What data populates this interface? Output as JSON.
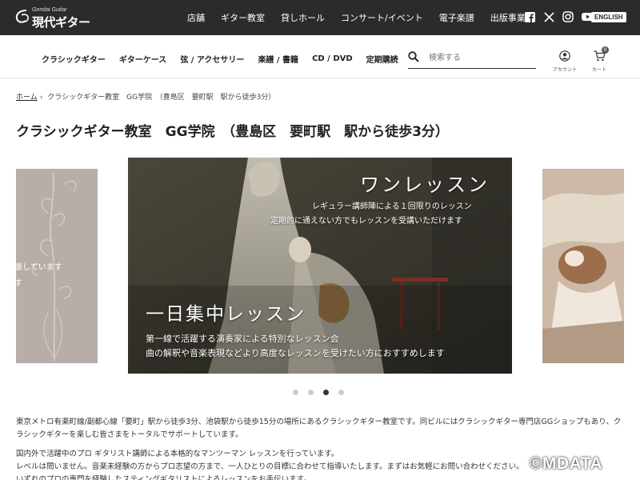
{
  "brand": {
    "logo_small": "Gendai Guitar",
    "logo_big": "現代ギター"
  },
  "topnav": {
    "items": [
      {
        "label": "店舗"
      },
      {
        "label": "ギター教室"
      },
      {
        "label": "貸しホール"
      },
      {
        "label": "コンサート/イベント"
      },
      {
        "label": "電子楽譜"
      },
      {
        "label": "出版事業"
      }
    ],
    "social": [
      "facebook-icon",
      "x-icon",
      "instagram-icon",
      "youtube-icon"
    ],
    "english_label": "ENGLISH"
  },
  "catnav": {
    "items": [
      {
        "label": "クラシックギター"
      },
      {
        "label": "ギターケース"
      },
      {
        "label": "弦 / アクセサリー"
      },
      {
        "label": "楽譜 / 書籍"
      },
      {
        "label": "CD / DVD"
      },
      {
        "label": "定期購読"
      }
    ]
  },
  "search": {
    "placeholder": "検索する",
    "icon": "search-icon"
  },
  "account": {
    "label": "アカウント",
    "icon": "user-icon"
  },
  "cart": {
    "label": "カート",
    "count": "0",
    "icon": "cart-icon"
  },
  "breadcrumb": {
    "home": "ホーム",
    "current": "クラシックギター教室　GG学院　（豊島区　要町駅　駅から徒歩3分）"
  },
  "page": {
    "title": "クラシックギター教室　GG学院　（豊島区　要町駅　駅から徒歩3分）"
  },
  "carousel": {
    "left_text_1": "援しています",
    "left_text_2": "す",
    "heading_1": "ワンレッスン",
    "text_1": "レギュラー講師陣による１回限りのレッスン",
    "text_2": "定期的に通えない方でもレッスンを受講いただけます",
    "heading_2": "一日集中レッスン",
    "text_3": "第一線で活躍する演奏家による特別なレッスン会",
    "text_4": "曲の解釈や音楽表現などより高度なレッスンを受けたい方におすすめします",
    "slide_count": 4,
    "active_index": 2
  },
  "description": {
    "p1": "東京メトロ有楽町線/副都心線「要町」駅から徒歩3分、池袋駅から徒歩15分の場所にあるクラシックギター教室です。同ビルにはクラシックギター専門店GGショップもあり、クラシックギターを楽しむ皆さまをトータルでサポートしています。",
    "p2a": "国内外で活躍中のプロ ギタリスト講師による本格的なマンツーマン レッスンを行っています。",
    "p2b": "レベルは問いません。音楽未経験の方からプロ志望の方まで、一人ひとりの目標に合わせて指導いたします。まずはお気軽にお問い合わせください。",
    "p2c": "いずれのプロの専門を経験したスティングギタリストによるレッスンをお手伝います。"
  },
  "watermark": "©MDATA"
}
